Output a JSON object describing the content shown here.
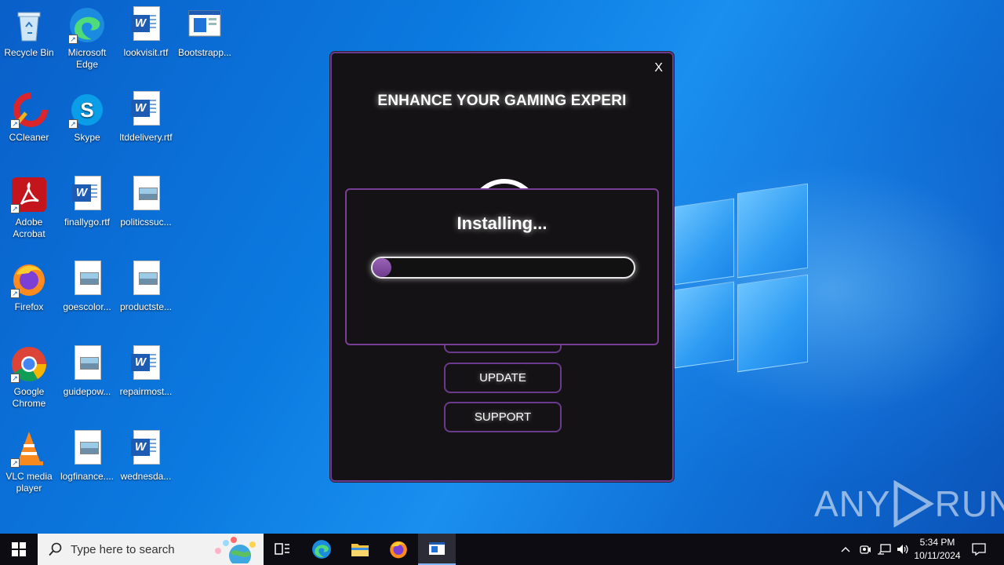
{
  "desktop": {
    "icons": [
      {
        "label": "Recycle Bin",
        "icon": "recycle-bin-icon"
      },
      {
        "label": "Microsoft Edge",
        "icon": "edge-icon"
      },
      {
        "label": "lookvisit.rtf",
        "icon": "word-document-icon"
      },
      {
        "label": "Bootstrapp...",
        "icon": "window-app-icon"
      },
      {
        "label": "CCleaner",
        "icon": "ccleaner-icon"
      },
      {
        "label": "Skype",
        "icon": "skype-icon"
      },
      {
        "label": "ltddelivery.rtf",
        "icon": "word-document-icon"
      },
      {
        "label": "Adobe Acrobat",
        "icon": "acrobat-icon"
      },
      {
        "label": "finallygo.rtf",
        "icon": "word-document-icon"
      },
      {
        "label": "politicssuc...",
        "icon": "image-file-icon"
      },
      {
        "label": "Firefox",
        "icon": "firefox-icon"
      },
      {
        "label": "goescolor...",
        "icon": "image-file-icon"
      },
      {
        "label": "productste...",
        "icon": "image-file-icon"
      },
      {
        "label": "Google Chrome",
        "icon": "chrome-icon"
      },
      {
        "label": "guidepow...",
        "icon": "image-file-icon"
      },
      {
        "label": "repairmost...",
        "icon": "word-document-icon"
      },
      {
        "label": "VLC media player",
        "icon": "vlc-icon"
      },
      {
        "label": "logfinance....",
        "icon": "image-file-icon"
      },
      {
        "label": "wednesda...",
        "icon": "word-document-icon"
      }
    ]
  },
  "installer": {
    "close_label": "X",
    "title": "ENHANCE YOUR GAMING EXPERI",
    "buttons": {
      "update": "UPDATE",
      "support": "SUPPORT"
    },
    "overlay": {
      "title": "Installing...",
      "progress_percent": 5
    },
    "accent_color": "#6a3a8c"
  },
  "taskbar": {
    "search_placeholder": "Type here to search",
    "pinned": [
      "task-view-icon",
      "edge-icon",
      "file-explorer-icon",
      "firefox-icon",
      "installer-app-icon"
    ],
    "clock": {
      "time": "5:34 PM",
      "date": "10/11/2024"
    }
  },
  "watermark": {
    "text_left": "ANY",
    "text_right": "RUN"
  }
}
